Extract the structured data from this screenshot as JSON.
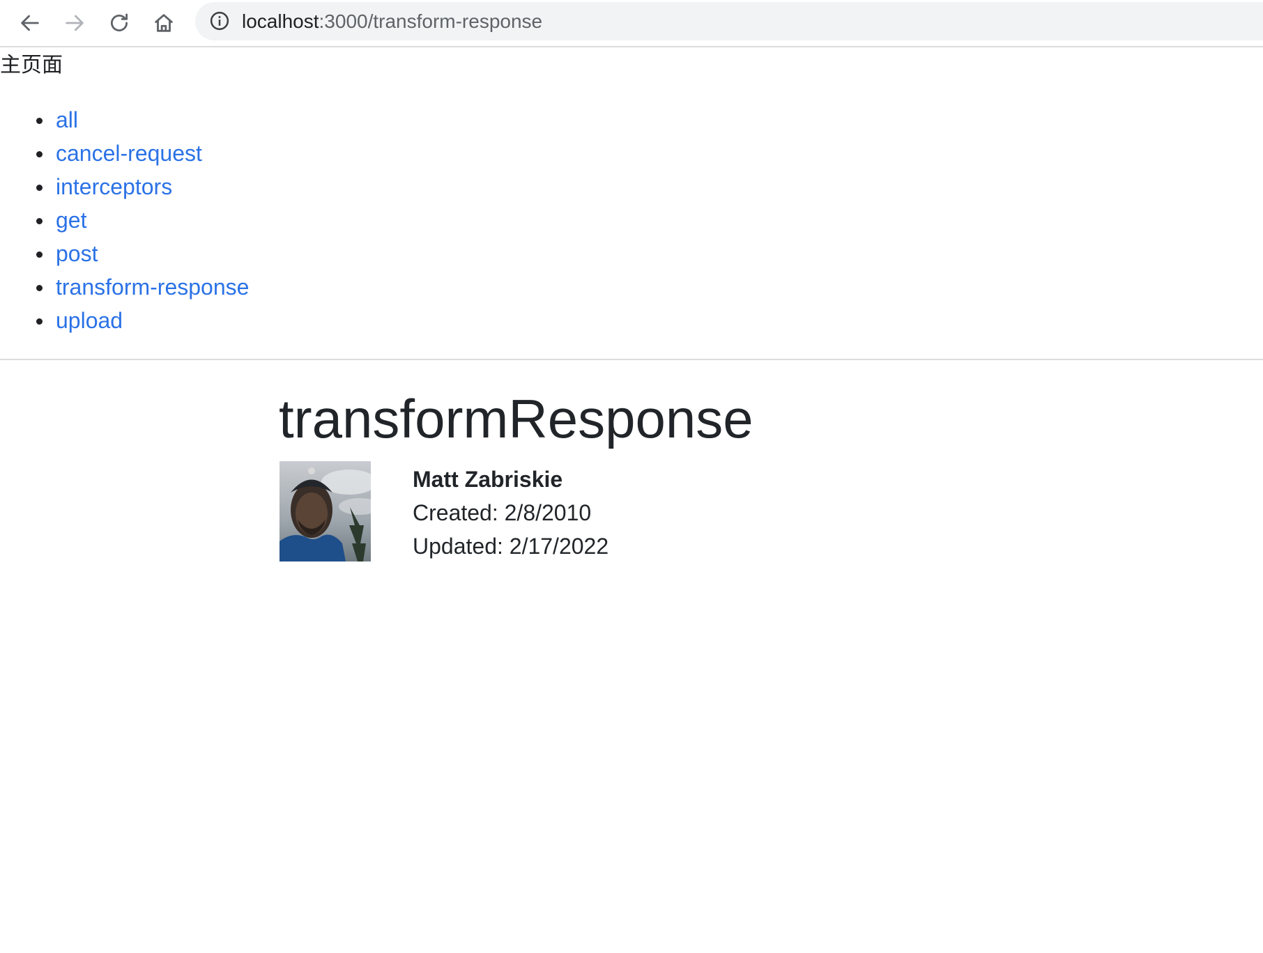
{
  "browser": {
    "url_host": "localhost",
    "url_path": ":3000/transform-response",
    "back_icon": "arrow-left-icon",
    "forward_icon": "arrow-right-icon",
    "reload_icon": "reload-icon",
    "home_icon": "home-icon",
    "info_icon": "info-icon"
  },
  "page": {
    "home_label": "主页面",
    "nav_links": [
      "all",
      "cancel-request",
      "interceptors",
      "get",
      "post",
      "transform-response",
      "upload"
    ],
    "title": "transformResponse",
    "user": {
      "name": "Matt Zabriskie",
      "created": "Created: 2/8/2010",
      "updated": "Updated: 2/17/2022"
    }
  },
  "colors": {
    "link": "#2b72e6",
    "text": "#212529",
    "omnibox_bg": "#f1f3f4"
  }
}
